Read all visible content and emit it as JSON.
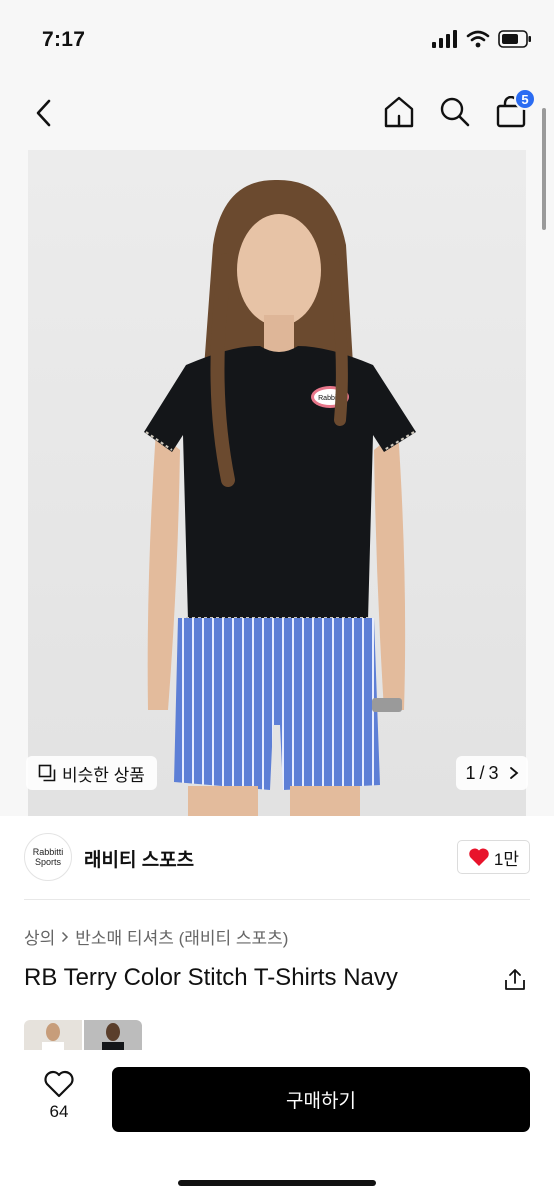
{
  "status_bar": {
    "time": "7:17",
    "icons": [
      "signal-icon",
      "wifi-icon",
      "battery-icon"
    ]
  },
  "header": {
    "cart_count": "5",
    "icons": [
      "back-icon",
      "home-icon",
      "search-icon",
      "cart-icon"
    ]
  },
  "gallery": {
    "similar_label": "비슷한 상품",
    "page_current": "1",
    "page_total": "3",
    "page_separator": "/",
    "logo_text": "Rabbitti"
  },
  "brand": {
    "logo_line1": "Rabbitti",
    "logo_line2": "Sports",
    "name": "래비티 스포츠",
    "like_count": "1만"
  },
  "breadcrumb": {
    "category": "상의",
    "subcategory": "반소매 티셔츠 (래비티 스포츠)"
  },
  "product": {
    "title": "RB Terry Color Stitch T-Shirts Navy"
  },
  "bottom": {
    "wish_count": "64",
    "buy_label": "구매하기"
  },
  "colors": {
    "accent": "#2b6cf2",
    "heart": "#e8132b",
    "buy_bg": "#000000"
  }
}
